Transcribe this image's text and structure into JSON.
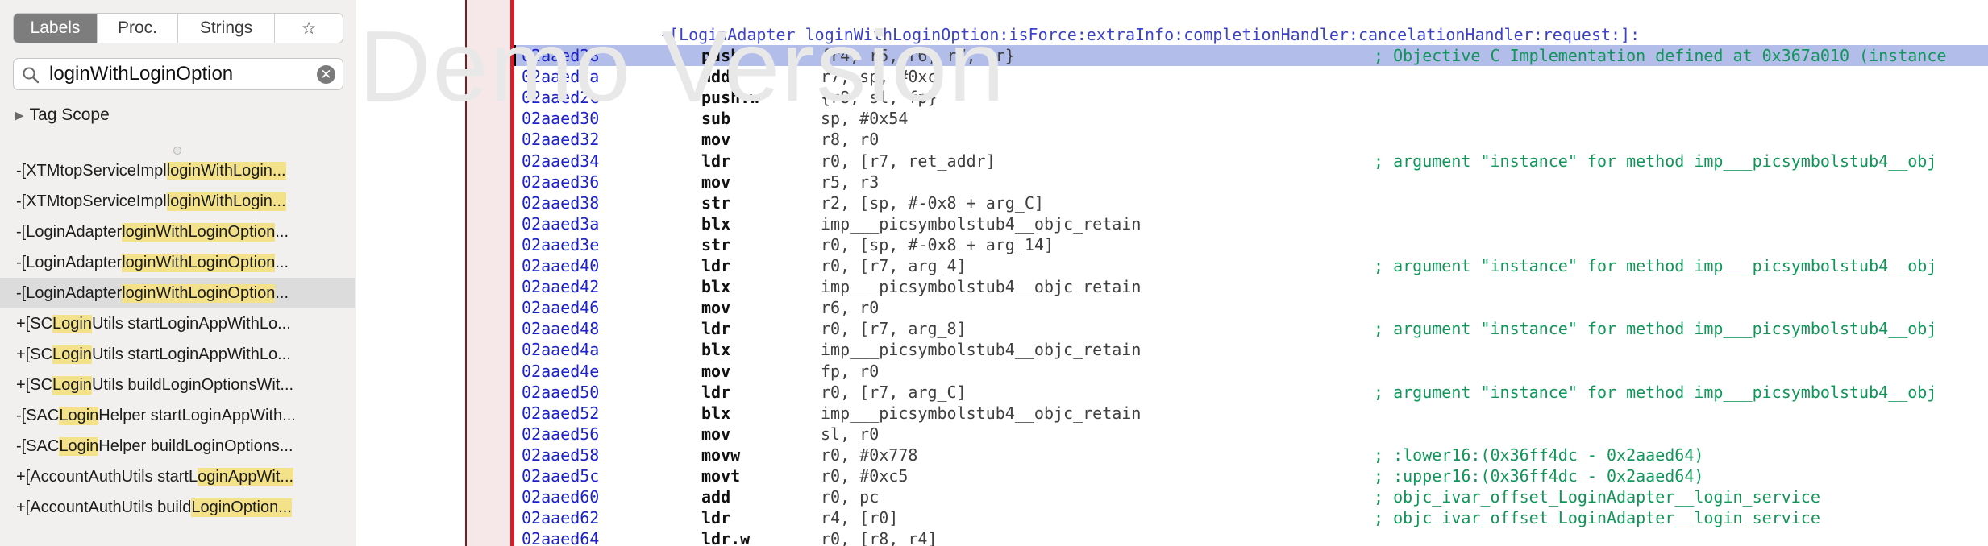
{
  "sidebar": {
    "tabs": [
      {
        "label": "Labels",
        "active": true
      },
      {
        "label": "Proc.",
        "active": false
      },
      {
        "label": "Strings",
        "active": false
      },
      {
        "label": "☆",
        "active": false,
        "icon": "star-icon"
      }
    ],
    "search": {
      "value": "loginWithLoginOption",
      "placeholder": ""
    },
    "tag_scope": "Tag Scope",
    "results": [
      {
        "pre": "-[XTMtopServiceImpl ",
        "hl": "loginWithLogin...",
        "post": ""
      },
      {
        "pre": "-[XTMtopServiceImpl ",
        "hl": "loginWithLogin...",
        "post": ""
      },
      {
        "pre": "-[LoginAdapter ",
        "hl": "loginWithLoginOption",
        "post": "..."
      },
      {
        "pre": "-[LoginAdapter ",
        "hl": "loginWithLoginOption",
        "post": "..."
      },
      {
        "pre": "-[LoginAdapter ",
        "hl": "loginWithLoginOption",
        "post": "...",
        "selected": true
      },
      {
        "pre": "+[SC",
        "hl": "Login",
        "post": "Utils startLoginAppWithLo..."
      },
      {
        "pre": "+[SC",
        "hl": "Login",
        "post": "Utils startLoginAppWithLo..."
      },
      {
        "pre": "+[SC",
        "hl": "Login",
        "post": "Utils buildLoginOptionsWit..."
      },
      {
        "pre": "-[SAC",
        "hl": "Login",
        "post": "Helper startLoginAppWith..."
      },
      {
        "pre": "-[SAC",
        "hl": "Login",
        "post": "Helper buildLoginOptions..."
      },
      {
        "pre": "+[AccountAuthUtils startL",
        "hl": "oginAppWit...",
        "post": ""
      },
      {
        "pre": "+[AccountAuthUtils build",
        "hl": "LoginOption...",
        "post": ""
      }
    ]
  },
  "watermark": "Demo Version",
  "code": {
    "header": "-[LoginAdapter loginWithLoginOption:isForce:extraInfo:completionHandler:cancelationHandler:request:]:",
    "lines": [
      {
        "addr": "02aaed28",
        "mnem": "push",
        "ops": "{r4, r5, r6, r7, lr}",
        "comment": "; Objective C Implementation defined at 0x367a010 (instance",
        "highlight": true
      },
      {
        "addr": "02aaed2a",
        "mnem": "add",
        "ops": "r7, sp, #0xc",
        "comment": ""
      },
      {
        "addr": "02aaed2c",
        "mnem": "push.w",
        "ops": "{r8, sl, fp}",
        "comment": ""
      },
      {
        "addr": "02aaed30",
        "mnem": "sub",
        "ops": "sp, #0x54",
        "comment": ""
      },
      {
        "addr": "02aaed32",
        "mnem": "mov",
        "ops": "r8, r0",
        "comment": ""
      },
      {
        "addr": "02aaed34",
        "mnem": "ldr",
        "ops": "r0, [r7, ret_addr]",
        "comment": "; argument \"instance\" for method imp___picsymbolstub4__obj"
      },
      {
        "addr": "02aaed36",
        "mnem": "mov",
        "ops": "r5, r3",
        "comment": ""
      },
      {
        "addr": "02aaed38",
        "mnem": "str",
        "ops": "r2, [sp, #-0x8 + arg_C]",
        "comment": ""
      },
      {
        "addr": "02aaed3a",
        "mnem": "blx",
        "ops": "imp___picsymbolstub4__objc_retain",
        "comment": ""
      },
      {
        "addr": "02aaed3e",
        "mnem": "str",
        "ops": "r0, [sp, #-0x8 + arg_14]",
        "comment": ""
      },
      {
        "addr": "02aaed40",
        "mnem": "ldr",
        "ops": "r0, [r7, arg_4]",
        "comment": "; argument \"instance\" for method imp___picsymbolstub4__obj"
      },
      {
        "addr": "02aaed42",
        "mnem": "blx",
        "ops": "imp___picsymbolstub4__objc_retain",
        "comment": ""
      },
      {
        "addr": "02aaed46",
        "mnem": "mov",
        "ops": "r6, r0",
        "comment": ""
      },
      {
        "addr": "02aaed48",
        "mnem": "ldr",
        "ops": "r0, [r7, arg_8]",
        "comment": "; argument \"instance\" for method imp___picsymbolstub4__obj"
      },
      {
        "addr": "02aaed4a",
        "mnem": "blx",
        "ops": "imp___picsymbolstub4__objc_retain",
        "comment": ""
      },
      {
        "addr": "02aaed4e",
        "mnem": "mov",
        "ops": "fp, r0",
        "comment": ""
      },
      {
        "addr": "02aaed50",
        "mnem": "ldr",
        "ops": "r0, [r7, arg_C]",
        "comment": "; argument \"instance\" for method imp___picsymbolstub4__obj"
      },
      {
        "addr": "02aaed52",
        "mnem": "blx",
        "ops": "imp___picsymbolstub4__objc_retain",
        "comment": ""
      },
      {
        "addr": "02aaed56",
        "mnem": "mov",
        "ops": "sl, r0",
        "comment": ""
      },
      {
        "addr": "02aaed58",
        "mnem": "movw",
        "ops": "r0, #0x778",
        "comment": "; :lower16:(0x36ff4dc - 0x2aaed64)"
      },
      {
        "addr": "02aaed5c",
        "mnem": "movt",
        "ops": "r0, #0xc5",
        "comment": "; :upper16:(0x36ff4dc - 0x2aaed64)"
      },
      {
        "addr": "02aaed60",
        "mnem": "add",
        "ops": "r0, pc",
        "comment": "; objc_ivar_offset_LoginAdapter__login_service"
      },
      {
        "addr": "02aaed62",
        "mnem": "ldr",
        "ops": "r4, [r0]",
        "comment": "; objc_ivar_offset_LoginAdapter__login_service"
      },
      {
        "addr": "02aaed64",
        "mnem": "ldr.w",
        "ops": "r0, [r8, r4]",
        "comment": ""
      }
    ]
  }
}
